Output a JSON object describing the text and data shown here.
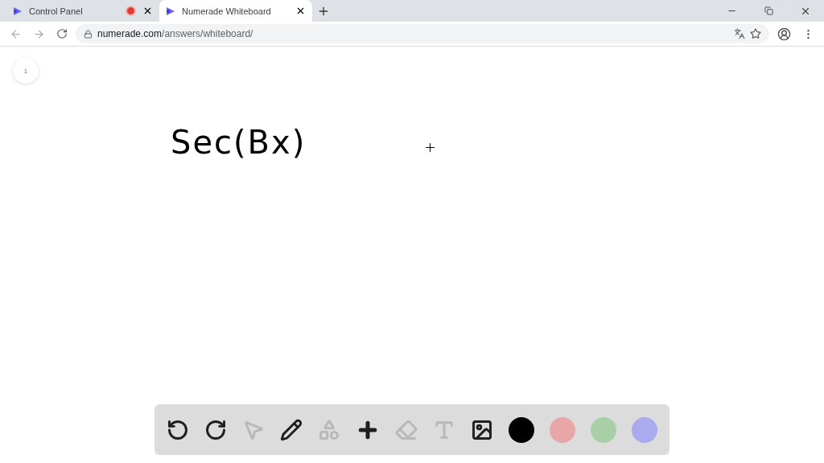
{
  "browser": {
    "tabs": [
      {
        "title": "Control Panel",
        "selected": false,
        "recording": true
      },
      {
        "title": "Numerade Whiteboard",
        "selected": true,
        "recording": false
      }
    ],
    "url": {
      "host": "numerade.com",
      "path": "/answers/whiteboard/"
    }
  },
  "whiteboard": {
    "page_number": "1",
    "writing": "Sec(Bx)",
    "tools": [
      {
        "kind": "undo",
        "disabled": false
      },
      {
        "kind": "redo",
        "disabled": false
      },
      {
        "kind": "select",
        "disabled": true
      },
      {
        "kind": "pen",
        "disabled": false
      },
      {
        "kind": "shapes",
        "disabled": true
      },
      {
        "kind": "add",
        "disabled": false
      },
      {
        "kind": "eraser",
        "disabled": true
      },
      {
        "kind": "text",
        "disabled": true
      },
      {
        "kind": "image",
        "disabled": false
      }
    ],
    "colors": [
      {
        "color": "#000000"
      },
      {
        "color": "#e8a6a6"
      },
      {
        "color": "#a9cfa8"
      },
      {
        "color": "#aaaaee"
      }
    ]
  }
}
